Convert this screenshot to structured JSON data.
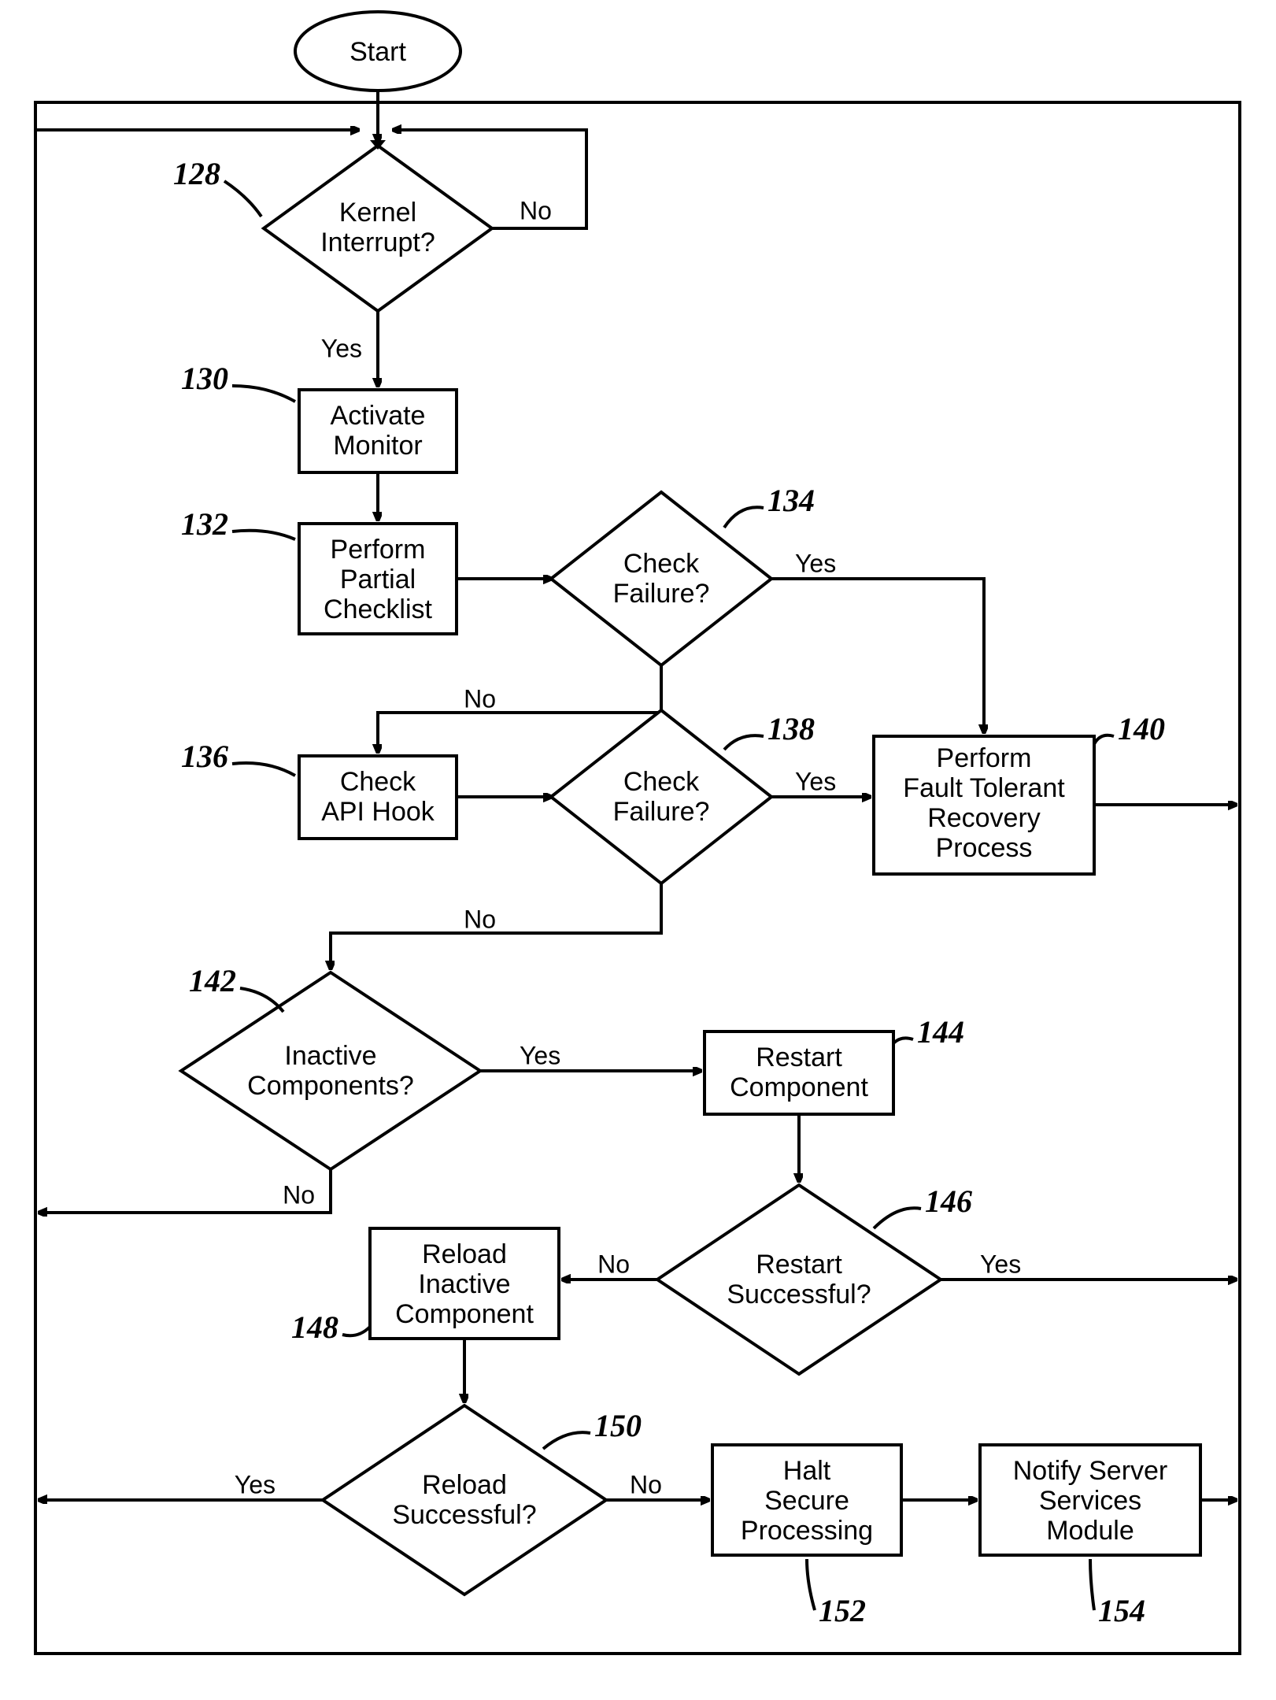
{
  "chart_data": {
    "type": "flowchart",
    "title": "",
    "nodes": [
      {
        "id": "start",
        "ref": "",
        "label": "Start",
        "shape": "terminator"
      },
      {
        "id": "128",
        "ref": "128",
        "label": "Kernel Interrupt?",
        "shape": "decision"
      },
      {
        "id": "130",
        "ref": "130",
        "label": "Activate Monitor",
        "shape": "process"
      },
      {
        "id": "132",
        "ref": "132",
        "label": "Perform Partial Checklist",
        "shape": "process"
      },
      {
        "id": "134",
        "ref": "134",
        "label": "Check Failure?",
        "shape": "decision"
      },
      {
        "id": "136",
        "ref": "136",
        "label": "Check API Hook",
        "shape": "process"
      },
      {
        "id": "138",
        "ref": "138",
        "label": "Check Failure?",
        "shape": "decision"
      },
      {
        "id": "140",
        "ref": "140",
        "label": "Perform Fault Tolerant Recovery Process",
        "shape": "process"
      },
      {
        "id": "142",
        "ref": "142",
        "label": "Inactive Components?",
        "shape": "decision"
      },
      {
        "id": "144",
        "ref": "144",
        "label": "Restart Component",
        "shape": "process"
      },
      {
        "id": "146",
        "ref": "146",
        "label": "Restart Successful?",
        "shape": "decision"
      },
      {
        "id": "148",
        "ref": "148",
        "label": "Reload Inactive Component",
        "shape": "process"
      },
      {
        "id": "150",
        "ref": "150",
        "label": "Reload Successful?",
        "shape": "decision"
      },
      {
        "id": "152",
        "ref": "152",
        "label": "Halt Secure Processing",
        "shape": "process"
      },
      {
        "id": "154",
        "ref": "154",
        "label": "Notify Server Services Module",
        "shape": "process"
      }
    ],
    "edges": [
      {
        "from": "start",
        "to": "128",
        "label": ""
      },
      {
        "from": "128",
        "to": "128",
        "label": "No"
      },
      {
        "from": "128",
        "to": "130",
        "label": "Yes"
      },
      {
        "from": "130",
        "to": "132",
        "label": ""
      },
      {
        "from": "132",
        "to": "134",
        "label": ""
      },
      {
        "from": "134",
        "to": "140",
        "label": "Yes"
      },
      {
        "from": "134",
        "to": "136",
        "label": "No"
      },
      {
        "from": "136",
        "to": "138",
        "label": ""
      },
      {
        "from": "138",
        "to": "140",
        "label": "Yes"
      },
      {
        "from": "138",
        "to": "142",
        "label": "No"
      },
      {
        "from": "140",
        "to": "128",
        "label": ""
      },
      {
        "from": "142",
        "to": "144",
        "label": "Yes"
      },
      {
        "from": "142",
        "to": "128",
        "label": "No"
      },
      {
        "from": "144",
        "to": "146",
        "label": ""
      },
      {
        "from": "146",
        "to": "128",
        "label": "Yes"
      },
      {
        "from": "146",
        "to": "148",
        "label": "No"
      },
      {
        "from": "148",
        "to": "150",
        "label": ""
      },
      {
        "from": "150",
        "to": "128",
        "label": "Yes"
      },
      {
        "from": "150",
        "to": "152",
        "label": "No"
      },
      {
        "from": "152",
        "to": "154",
        "label": ""
      },
      {
        "from": "154",
        "to": "128",
        "label": ""
      }
    ]
  },
  "labels": {
    "start": "Start",
    "n128": "Kernel\nInterrupt?",
    "n130": "Activate\nMonitor",
    "n132": "Perform\nPartial\nChecklist",
    "n134": "Check\nFailure?",
    "n136": "Check\nAPI Hook",
    "n138": "Check\nFailure?",
    "n140_l1": "Perform",
    "n140_l2": "Fault Tolerant",
    "n140_l3": "Recovery",
    "n140_l4": "Process",
    "n142": "Inactive\nComponents?",
    "n144": "Restart\nComponent",
    "n146": "Restart\nSuccessful?",
    "n148": "Reload\nInactive\nComponent",
    "n150": "Reload\nSuccessful?",
    "n152": "Halt\nSecure\nProcessing",
    "n154": "Notify Server\nServices\nModule",
    "yes": "Yes",
    "no": "No"
  },
  "refs": {
    "r128": "128",
    "r130": "130",
    "r132": "132",
    "r134": "134",
    "r136": "136",
    "r138": "138",
    "r140": "140",
    "r142": "142",
    "r144": "144",
    "r146": "146",
    "r148": "148",
    "r150": "150",
    "r152": "152",
    "r154": "154"
  }
}
